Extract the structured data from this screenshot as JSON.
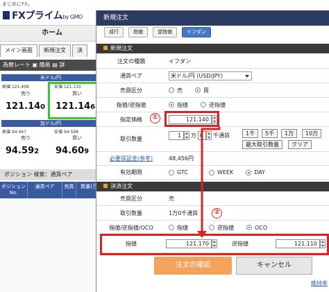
{
  "app": {
    "tagline": "まじめにFX。",
    "logo": "FXプライム",
    "logo_suffix": "by GMO",
    "home": "ホーム"
  },
  "bg_tabs": [
    "メイン画面",
    "新規注文",
    "決"
  ],
  "rate_bar": {
    "label": "為替レート",
    "mode1": "簡易",
    "mode2": "詳"
  },
  "pairs": [
    {
      "name": "米ドル/円",
      "high_label": "高値",
      "high": "121.408",
      "low_label": "安値",
      "low": "121.110",
      "sell_label": "売り",
      "buy_label": "買い",
      "sell_main": "121.14",
      "sell_small": "0",
      "buy_main": "121.14",
      "buy_small": "6"
    },
    {
      "name": "加ドル/円",
      "high_label": "高値",
      "high": "94.947",
      "low_label": "安値",
      "low": "94.598",
      "sell_label": "売り",
      "buy_label": "買い",
      "sell_main": "94.59",
      "sell_small": "2",
      "buy_main": "94.60",
      "buy_small": "9"
    }
  ],
  "position": {
    "title": "ポジション",
    "search": "検索：通貨ペア",
    "cols": [
      "ポジション No.",
      "通貨ペア",
      "売買",
      "数量(万)"
    ]
  },
  "dialog": {
    "title": "新規注文",
    "toolbar": [
      "成行",
      "指値",
      "逆指値",
      "イフダン"
    ],
    "new_section": "新規注文",
    "order_type_label": "注文の種類",
    "order_type": "イフダン",
    "pair_label": "通貨ペア",
    "pair_value": "米ドル/円 (USD/JPY)",
    "side_label": "売買区分",
    "side_sell": "売",
    "side_buy": "買",
    "limit_type_label": "指値/逆指値",
    "limit": "指値",
    "stop": "逆指値",
    "price_label": "指定価格",
    "price_value": "121.140",
    "qty_label": "取引数量",
    "qty_value": "1",
    "qty_unit": "万",
    "qty_currency": "千通貨",
    "qty_buttons": [
      "1千",
      "5千",
      "1万",
      "10万"
    ],
    "max_qty": "最大取引数量",
    "clear": "クリア",
    "margin_label": "必要保証金(参考)",
    "margin_value": "48,456円",
    "expiry_label": "有効期限",
    "expiry_gtc": "GTC",
    "expiry_week": "WEEK",
    "expiry_day": "DAY",
    "settle_section": "決済注文",
    "settle_side_label": "売買区分",
    "settle_side": "売",
    "settle_qty_label": "取引数量",
    "settle_qty": "1万0千通貨",
    "settle_type_label": "指値/逆指値/OCO",
    "settle_limit": "指値",
    "settle_stop": "逆指値",
    "settle_oco": "OCO",
    "limit_price_label": "指値",
    "limit_price": "121.170",
    "stop_price_label": "逆指値",
    "stop_price": "121.110",
    "confirm": "注文の確認",
    "cancel": "キャンセル",
    "footer_link": "維持率"
  },
  "annotations": {
    "one": "①",
    "two": "②"
  },
  "colors": {
    "title_bar": "#2b3b62",
    "active_tab": "#4679c4",
    "highlight_green": "#3ac43a",
    "highlight_red": "#e02020",
    "confirm": "#f4a25c"
  }
}
